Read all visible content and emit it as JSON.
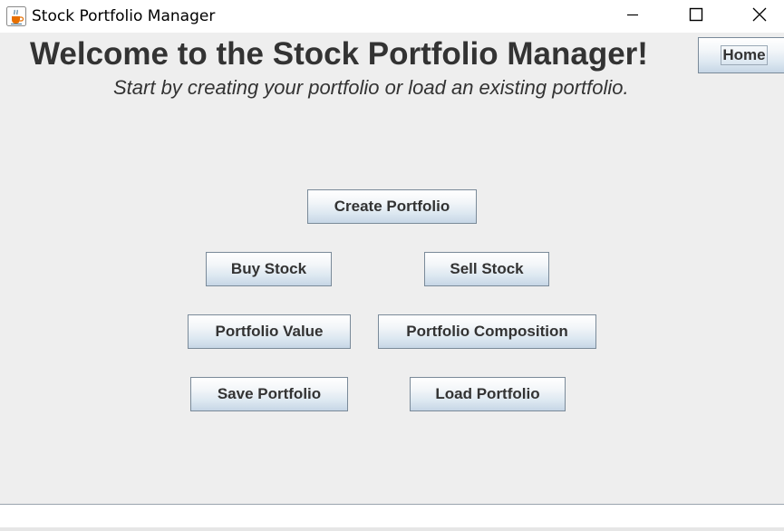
{
  "window": {
    "title": "Stock Portfolio Manager",
    "app_icon": "java-cup-icon",
    "controls": [
      "minimize-icon",
      "maximize-icon",
      "close-icon"
    ]
  },
  "header": {
    "welcome": "Welcome to the Stock Portfolio Manager!",
    "subtitle": "Start by creating your portfolio or load an existing portfolio.",
    "home_label": "Home"
  },
  "actions": {
    "create": "Create Portfolio",
    "buy": "Buy Stock",
    "sell": "Sell Stock",
    "value": "Portfolio Value",
    "composition": "Portfolio Composition",
    "save": "Save Portfolio",
    "load": "Load Portfolio"
  },
  "status": {
    "message": ""
  },
  "colors": {
    "background": "#eeeeee",
    "text": "#333333",
    "button_border": "#7a8a99",
    "button_gradient_bottom": "#c6d6e6"
  }
}
